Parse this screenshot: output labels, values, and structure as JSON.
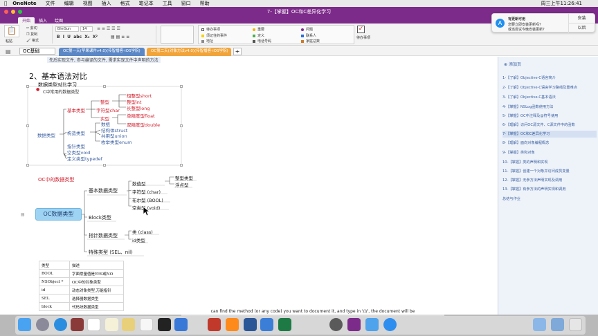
{
  "menubar": {
    "app_name": "OneNote",
    "items": [
      "文件",
      "编辑",
      "视图",
      "插入",
      "格式",
      "笔记本",
      "工具",
      "窗口",
      "帮助"
    ],
    "clock": "周三上午11:26:41"
  },
  "window": {
    "title": "7-【掌握】OC和C差异化学习"
  },
  "ribbon": {
    "tabs": [
      "开始",
      "插入",
      "绘图"
    ],
    "active_tab": "开始",
    "paste_label": "粘贴",
    "cut_label": "剪切",
    "copy_label": "复制",
    "format_label": "格式",
    "font_name": "BlmSun",
    "font_size": "14",
    "tags": [
      "待办事项",
      "重要",
      "问题",
      "须记住的事件",
      "定义",
      "联系人",
      "地址",
      "电话号码",
      "家庭总数"
    ],
    "todo_tag_label": "待办事项",
    "todo_button_label": "待办\n事项",
    "colors": {
      "purple": "#7d2b8a",
      "tab_blue": "#5b87c5",
      "tab_orange": "#f1a43a",
      "red_text": "#d11d2b",
      "root_node": "#9fd3f3",
      "pane_link": "#3a5fa0"
    }
  },
  "notification": {
    "icon": "app-store-icon",
    "line1": "有更新可用",
    "line2": "您要立即安装更新吗？",
    "line3": "或当尝试今晚安装更新?",
    "install_label": "安装",
    "later_label": "以后"
  },
  "notebook": {
    "name": "OC基础",
    "sections": [
      "OC第一天(苹果课件v4.0)(传智播客-iOS学院)",
      "OC第二天(对象方法v4.0)(传智播客-iOS学院)"
    ],
    "add_section": "+"
  },
  "page": {
    "top_hint": "先后实现文件, 参与编译的文件, 需求实现文件中声明的方法",
    "heading": "2、基本语法对比",
    "subheading": "数据类型对比学习",
    "c_types": {
      "title": "C中常用的数据类型",
      "root": "数据类型",
      "basic": "基本类型",
      "integer": "整型",
      "short": "短整型short",
      "int": "整型int",
      "long": "长整型long",
      "char": "字符型char",
      "real": "实型",
      "float": "单精度型float",
      "double": "双精度型double",
      "construct": "构造类型",
      "array": "数组",
      "struct": "结构体struct",
      "union": "共用型union",
      "enum": "枚举类型enum",
      "pointer": "指针类型",
      "void": "空类型void",
      "typedef": "定义类型typedef"
    },
    "oc_types": {
      "title": "OC中的数据类型",
      "root": "OC数据类型",
      "basic": "基本数据类型",
      "numeric": "数值型",
      "integer": "整型类型",
      "float": "浮点型",
      "char": "字符型 (char)",
      "bool": "布尔型 (BOOL)",
      "void": "空类型 (void)",
      "block": "Block类型",
      "pointer": "指针数据类型",
      "class": "类 (class)",
      "id": "id类型",
      "special": "特殊类型 (SEL、nil)"
    },
    "table": {
      "headers": [
        "类型",
        "描述"
      ],
      "rows": [
        [
          "BOOL",
          "字面常量值是YES或NO"
        ],
        [
          "NSObject *",
          "OC中的对象类型"
        ],
        [
          "id",
          "动态对象类型,万能指针"
        ],
        [
          "SEL",
          "选择器数据类型"
        ],
        [
          "block",
          "代码块数据类型"
        ]
      ]
    }
  },
  "page_list": {
    "add_page": "添加页",
    "pages": [
      "1-【了解】Objective-C语言简介",
      "2-【了解】Objective-C语言学习路线及重难点",
      "3-【了解】Objective-C基本语法",
      "4-【掌握】NSLog函数使用方法",
      "5-【掌握】OC中注释及@符号使用",
      "6-【理解】访问OC源文件、C源文件中的函数",
      "7-【掌握】OC和C差异化学习",
      "8-【理解】面向对象编程概念",
      "9-【掌握】类和对象",
      "10-【掌握】类的声明和实现",
      "11-【掌握】创建一个对象并访问成员变量",
      "12-【掌握】无参方法声明实现及调用",
      "13-【掌握】有参方法的声明实现和调用",
      "总结与作业"
    ],
    "selected_index": 6
  },
  "overlay_caption": "can find the method (or any code) you want to document it, and type in '///', the document will be",
  "dock": {
    "apps": [
      "finder-icon",
      "launchpad-icon",
      "safari-icon",
      "dictionary-icon",
      "calendar-icon",
      "notes-icon",
      "preview-icon",
      "photos-icon",
      "terminal-icon",
      "xcode-icon",
      "filezilla-icon",
      "sublime-icon",
      "word-icon",
      "keynote-icon",
      "excel-icon",
      "instruments-icon",
      "onenote-icon",
      "mail-icon",
      "appstore-icon",
      "folder-icon",
      "downloads-icon",
      "trash-icon"
    ]
  }
}
